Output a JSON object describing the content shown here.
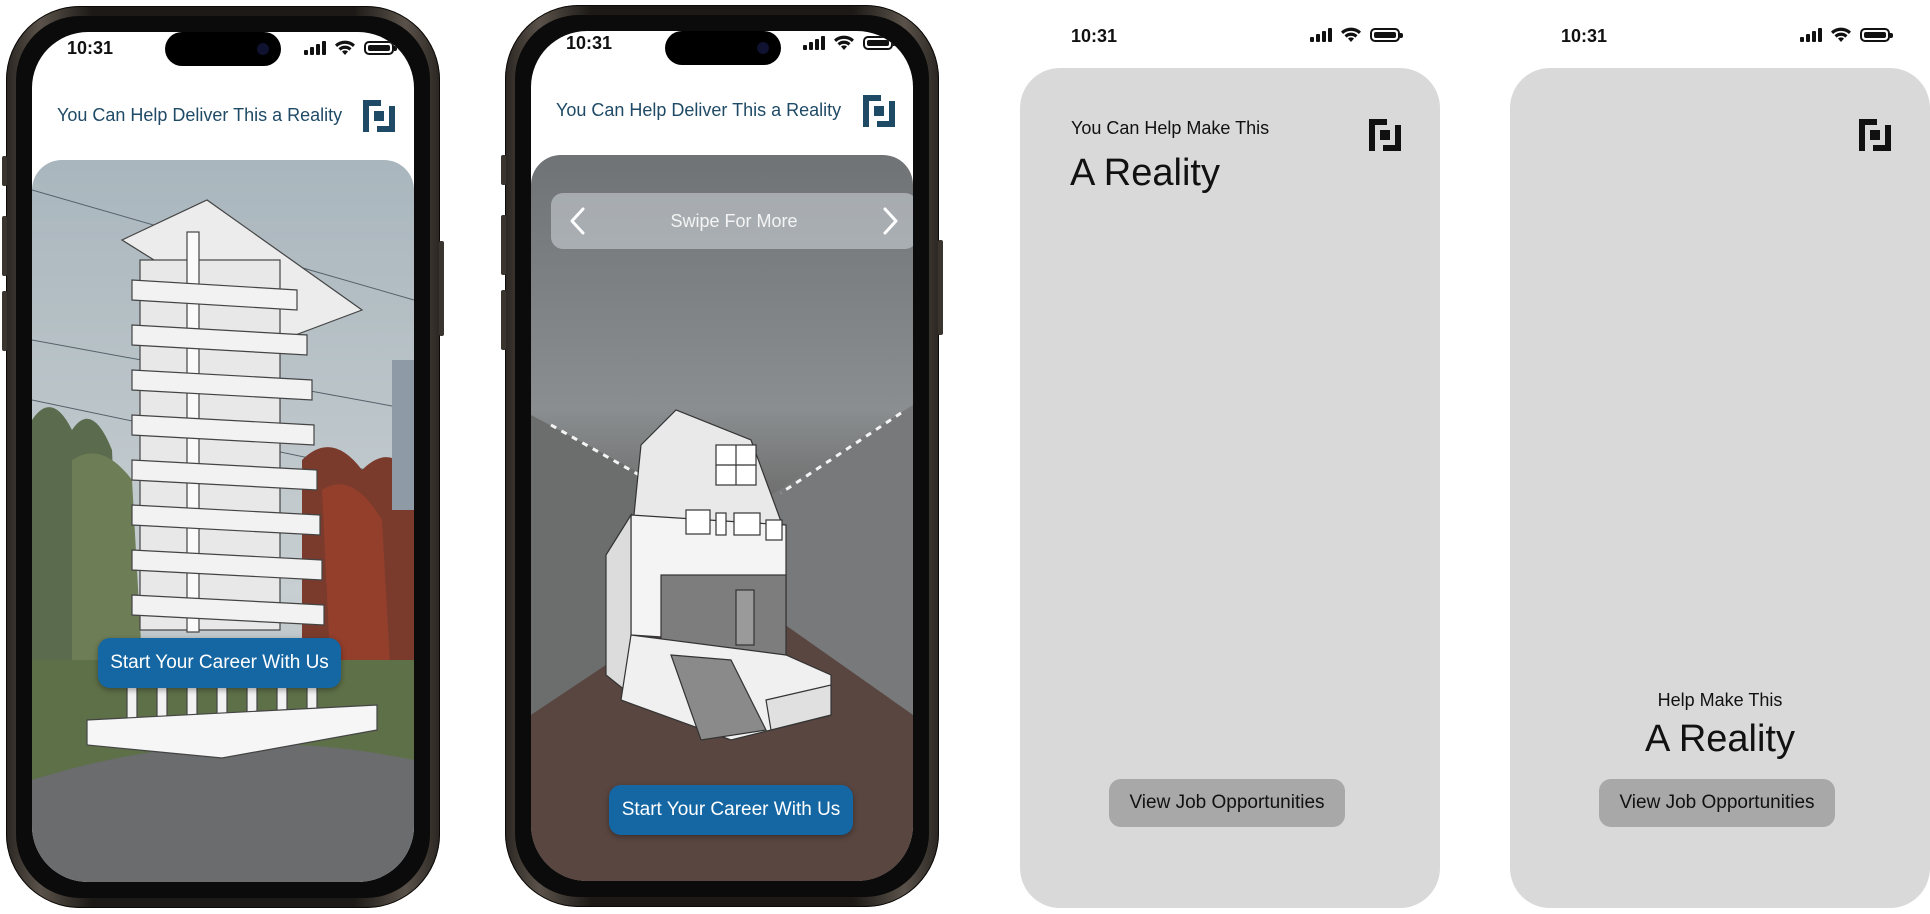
{
  "status_bar": {
    "time": "10:31"
  },
  "screens": [
    {
      "header": "You Can Help Deliver This a Reality",
      "cta": "Start Your Career With Us"
    },
    {
      "header": "You Can Help Deliver This a Reality",
      "carousel": {
        "label": "Swipe For More"
      },
      "cta": "Start Your Career With Us"
    },
    {
      "eyebrow": "You Can Help Make This",
      "title": "A Reality",
      "button": "View Job Opportunities"
    },
    {
      "eyebrow": "Help Make This",
      "title": "A Reality",
      "button": "View Job Opportunities"
    }
  ],
  "colors": {
    "brand_navy": "#1f4a66",
    "cta_blue": "#1567a4",
    "card_gray": "#d9d9d9",
    "button_gray": "#a8a8a8"
  },
  "icons": [
    "brand-logo-icon",
    "signal-icon",
    "wifi-icon",
    "battery-icon",
    "chevron-left-icon",
    "chevron-right-icon"
  ]
}
